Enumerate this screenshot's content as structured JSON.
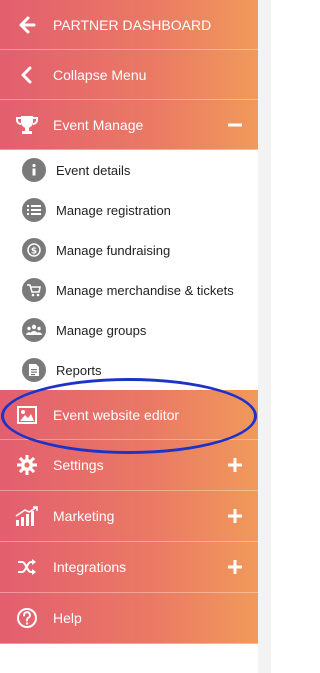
{
  "menu": {
    "partner_dashboard": "PARTNER DASHBOARD",
    "collapse_menu": "Collapse Menu",
    "event_manage": "Event Manage",
    "event_website_editor": "Event website editor",
    "settings": "Settings",
    "marketing": "Marketing",
    "integrations": "Integrations",
    "help": "Help"
  },
  "submenu": [
    {
      "label": "Event details",
      "icon": "info-icon"
    },
    {
      "label": "Manage registration",
      "icon": "list-icon"
    },
    {
      "label": "Manage fundraising",
      "icon": "dollar-icon"
    },
    {
      "label": "Manage merchandise & tickets",
      "icon": "cart-icon"
    },
    {
      "label": "Manage groups",
      "icon": "groups-icon"
    },
    {
      "label": "Reports",
      "icon": "report-icon"
    }
  ],
  "colors": {
    "gradient_left": "#e35e6f",
    "gradient_right": "#f09a5b",
    "highlight_ellipse": "#1e32c8"
  }
}
